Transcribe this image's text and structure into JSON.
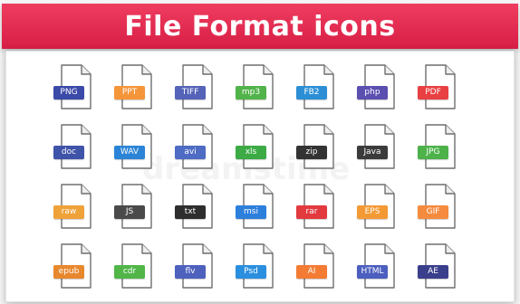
{
  "title": "File Format icons",
  "watermark": "dreamstime",
  "files": [
    {
      "ext": "PNG",
      "color": "#3b4aa8"
    },
    {
      "ext": "PPT",
      "color": "#f5953a"
    },
    {
      "ext": "TIFF",
      "color": "#5564b8"
    },
    {
      "ext": "mp3",
      "color": "#52b34a"
    },
    {
      "ext": "FB2",
      "color": "#2c8fd6"
    },
    {
      "ext": "php",
      "color": "#5b4fb0"
    },
    {
      "ext": "PDF",
      "color": "#e94043"
    },
    {
      "ext": "doc",
      "color": "#3f53a8"
    },
    {
      "ext": "WAV",
      "color": "#2b84d6"
    },
    {
      "ext": "avi",
      "color": "#4e6cc4"
    },
    {
      "ext": "xls",
      "color": "#3cab45"
    },
    {
      "ext": "zip",
      "color": "#333333"
    },
    {
      "ext": "Java",
      "color": "#3b3b3b"
    },
    {
      "ext": "JPG",
      "color": "#4db24a"
    },
    {
      "ext": "raw",
      "color": "#f0a23a"
    },
    {
      "ext": "JS",
      "color": "#4a4a4a"
    },
    {
      "ext": "txt",
      "color": "#2e2e2e"
    },
    {
      "ext": "msi",
      "color": "#2d7fdc"
    },
    {
      "ext": "rar",
      "color": "#e23a3f"
    },
    {
      "ext": "EPS",
      "color": "#f39a35"
    },
    {
      "ext": "GIF",
      "color": "#f48b3f"
    },
    {
      "ext": "epub",
      "color": "#e8882d"
    },
    {
      "ext": "cdr",
      "color": "#51b548"
    },
    {
      "ext": "flv",
      "color": "#4d61bd"
    },
    {
      "ext": "Psd",
      "color": "#2b8fe0"
    },
    {
      "ext": "AI",
      "color": "#f47b33"
    },
    {
      "ext": "HTML",
      "color": "#4c5fbf"
    },
    {
      "ext": "AE",
      "color": "#3a3f8c"
    }
  ]
}
